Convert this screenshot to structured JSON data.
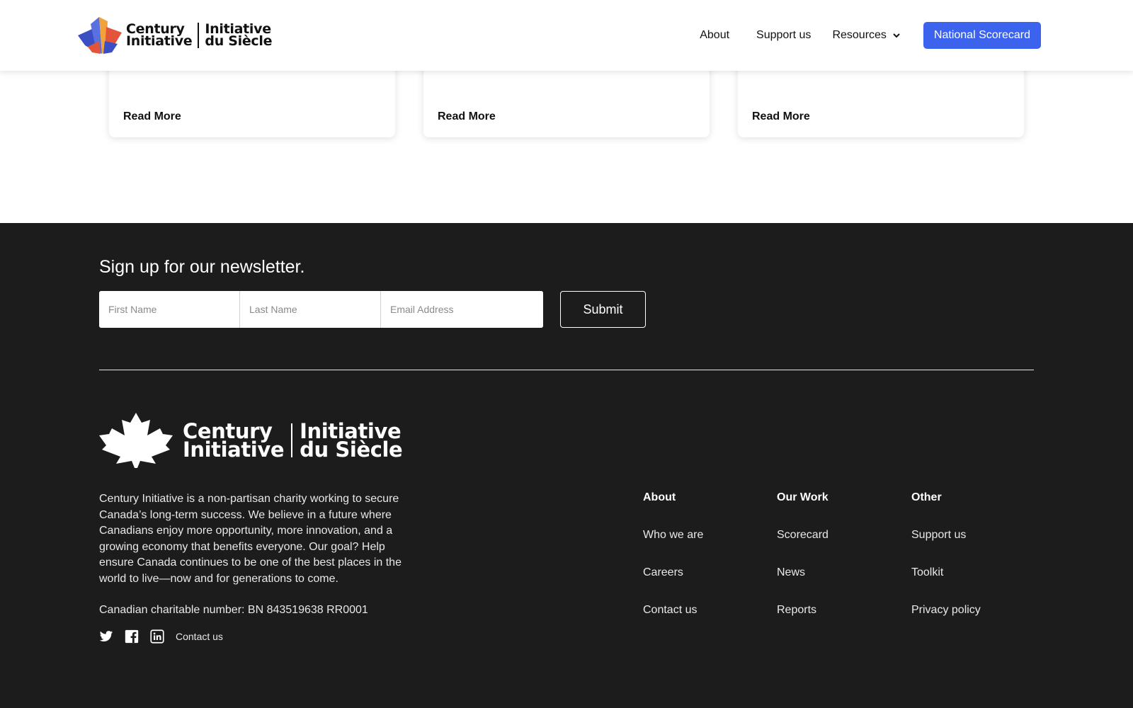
{
  "header": {
    "logo": {
      "line1_en": "Century",
      "line2_en": "Initiative",
      "line1_fr": "Initiative",
      "line2_fr": "du Siècle"
    },
    "nav": {
      "about": "About",
      "support": "Support us",
      "resources": "Resources",
      "cta": "National Scorecard"
    }
  },
  "cards": [
    {
      "link": "Read More"
    },
    {
      "link": "Read More"
    },
    {
      "link": "Read More"
    }
  ],
  "newsletter": {
    "title": "Sign up for our newsletter.",
    "first_name_placeholder": "First Name",
    "last_name_placeholder": "Last Name",
    "email_placeholder": "Email Address",
    "submit": "Submit"
  },
  "footer": {
    "logo": {
      "line1_en": "Century",
      "line2_en": "Initiative",
      "line1_fr": "Initiative",
      "line2_fr": "du Siècle"
    },
    "description": "Century Initiative is a non-partisan charity working to secure Canada’s long-term success. We believe in a future where Canadians enjoy more opportunity, more innovation, and a growing economy that benefits everyone. Our goal? Help ensure Canada continues to be one of the best places in the world to live—now and for generations to come.",
    "charity_number": "Canadian charitable number: BN 843519638 RR0001",
    "social": {
      "icons": [
        "twitter-icon",
        "facebook-icon",
        "linkedin-icon"
      ],
      "contact": "Contact us"
    },
    "columns": [
      {
        "heading": "About",
        "links": [
          "Who we are",
          "Careers",
          "Contact us"
        ]
      },
      {
        "heading": "Our Work",
        "links": [
          "Scorecard",
          "News",
          "Reports"
        ]
      },
      {
        "heading": "Other",
        "links": [
          "Support us",
          "Toolkit",
          "Privacy policy"
        ]
      }
    ]
  },
  "colors": {
    "accent": "#3b63ee",
    "footer_bg": "#1c1c1c",
    "logo_orange": "#f0a33a",
    "logo_red": "#e2553a",
    "logo_blue": "#3b4fc4"
  }
}
